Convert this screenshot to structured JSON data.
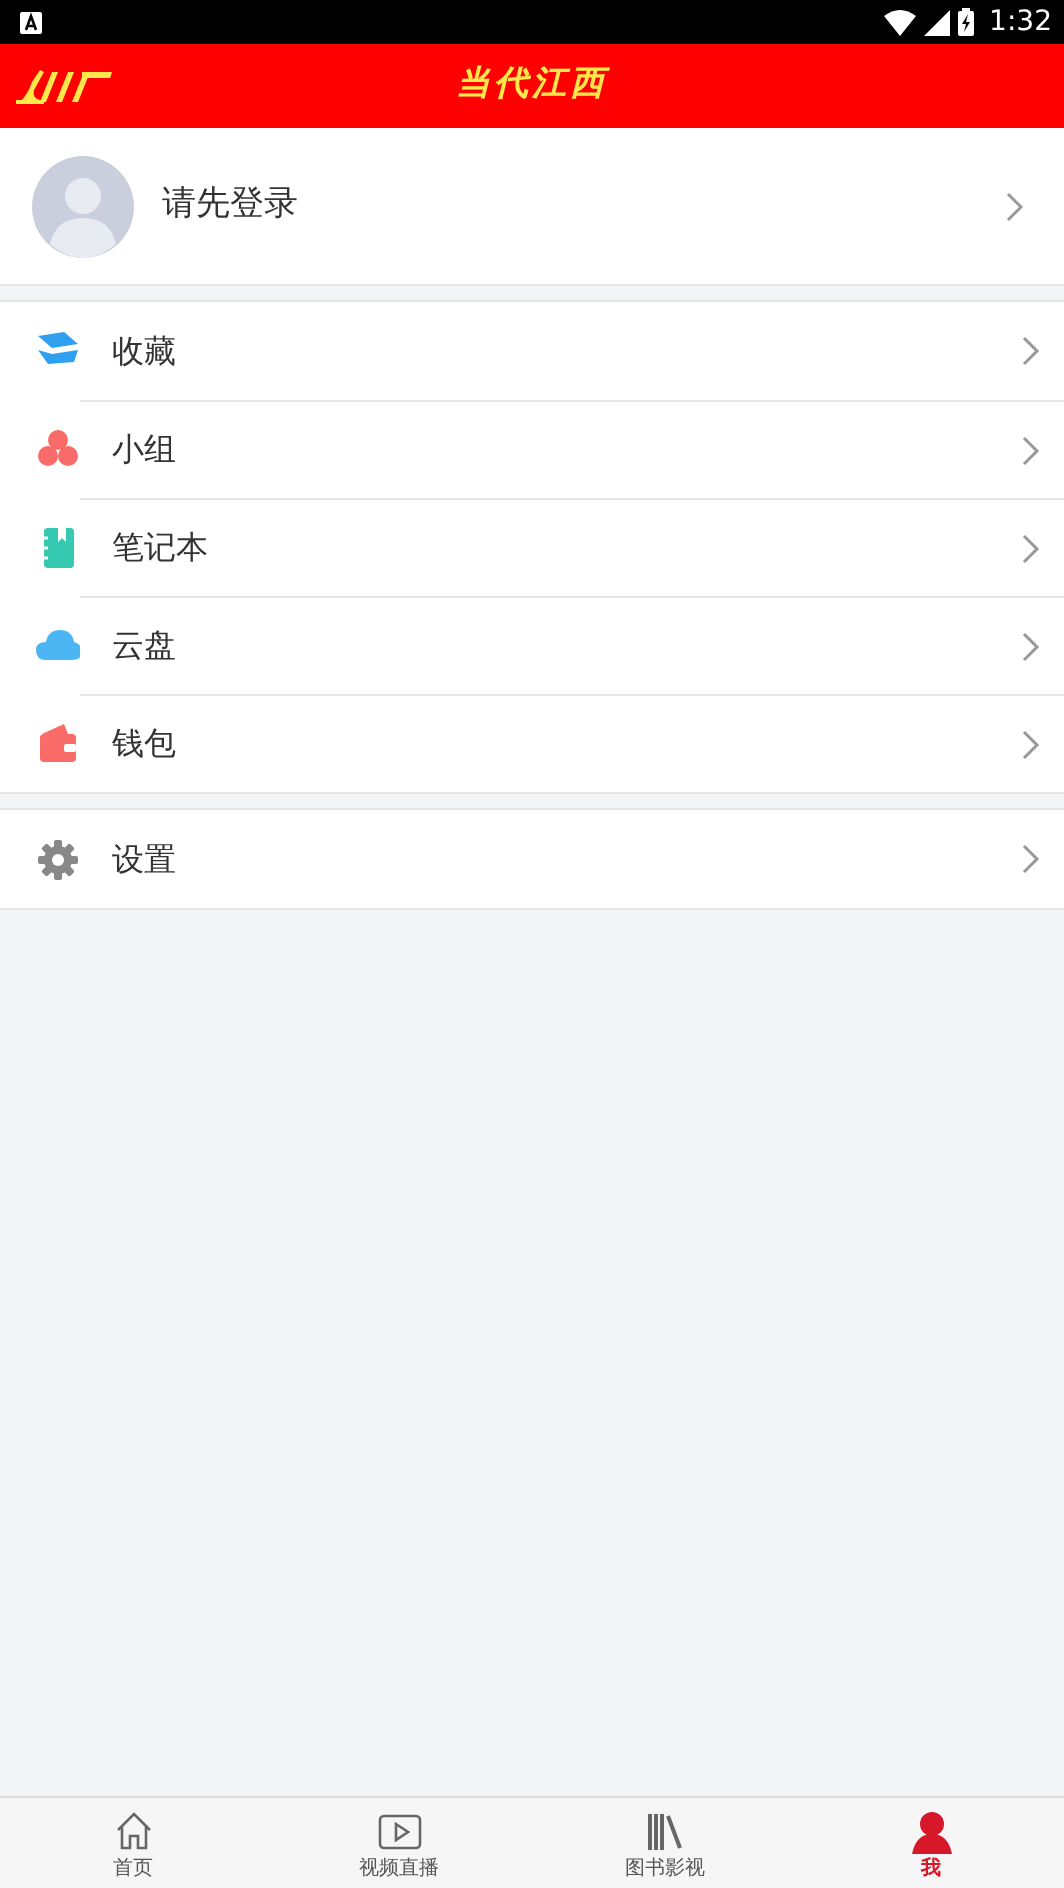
{
  "status_bar": {
    "time": "1:32"
  },
  "header": {
    "title": "当代江西"
  },
  "profile": {
    "label": "请先登录"
  },
  "menu_groups": [
    {
      "items": [
        {
          "label": "收藏",
          "kind": "favorites"
        },
        {
          "label": "小组",
          "kind": "group"
        },
        {
          "label": "笔记本",
          "kind": "notebook"
        },
        {
          "label": "云盘",
          "kind": "cloud"
        },
        {
          "label": "钱包",
          "kind": "wallet"
        }
      ]
    },
    {
      "items": [
        {
          "label": "设置",
          "kind": "settings"
        }
      ]
    }
  ],
  "tabs": [
    {
      "label": "首页",
      "kind": "home",
      "selected": false
    },
    {
      "label": "视频直播",
      "kind": "video",
      "selected": false
    },
    {
      "label": "图书影视",
      "kind": "books",
      "selected": false
    },
    {
      "label": "我",
      "kind": "me",
      "selected": true
    }
  ]
}
